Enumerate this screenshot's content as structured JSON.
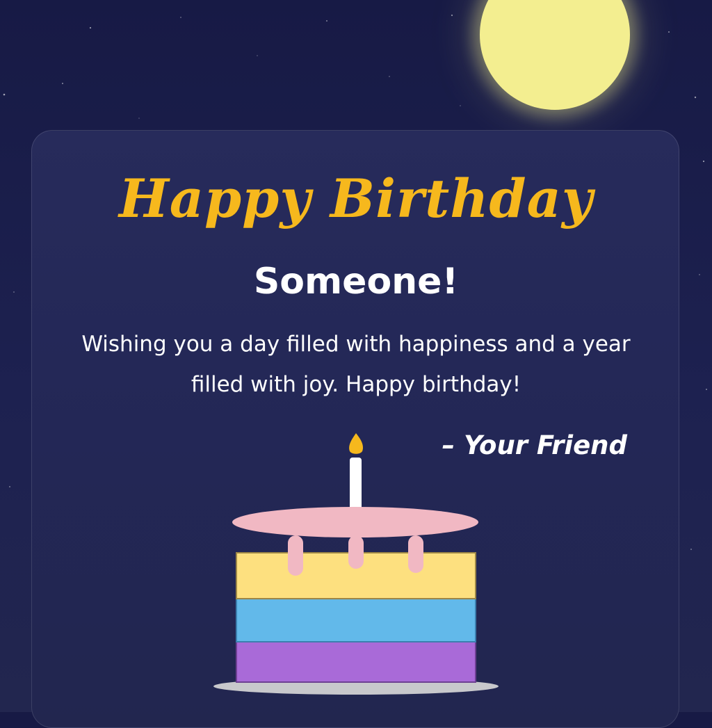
{
  "card": {
    "title": "Happy Birthday",
    "name": "Someone!",
    "message": "Wishing you a day filled with happiness and a year filled with joy. Happy birthday!",
    "signature": "– Your Friend"
  },
  "colors": {
    "background": "#1b1e4b",
    "card": "#252957",
    "title": "#f6b81d",
    "moon": "#f3ee90",
    "frosting": "#f1b8c3",
    "layer_top": "#fde07f",
    "layer_middle": "#62b9ea",
    "layer_bottom": "#a96ad8",
    "candle_flame": "#f6b81d",
    "plate": "#c8c8cc"
  },
  "icons": [
    "moon-icon",
    "birthday-cake-icon",
    "candle-icon",
    "star-icon"
  ]
}
